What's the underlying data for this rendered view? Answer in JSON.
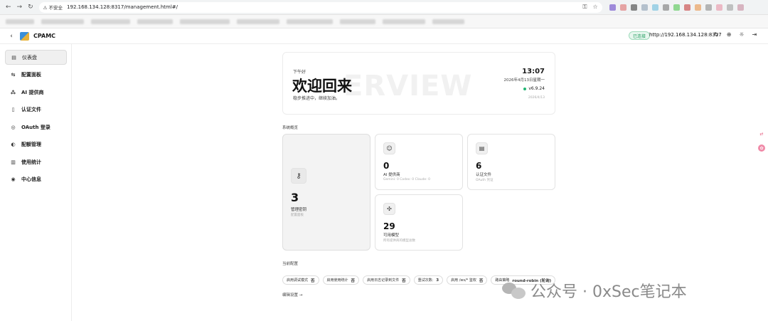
{
  "browser": {
    "insecure": "不安全",
    "url": "192.168.134.128:8317/management.html#/"
  },
  "header": {
    "back": "‹",
    "brand": "CPAMC",
    "status": "已连接",
    "server": "http://192.168.134.128:8317"
  },
  "sidebar": {
    "items": [
      {
        "label": "仪表盘",
        "icon": "dashboard-icon",
        "glyph": "▤"
      },
      {
        "label": "配置面板",
        "icon": "sliders-icon",
        "glyph": "⇆"
      },
      {
        "label": "AI 提供商",
        "icon": "network-icon",
        "glyph": "⁂"
      },
      {
        "label": "认证文件",
        "icon": "file-icon",
        "glyph": "▯"
      },
      {
        "label": "OAuth 登录",
        "icon": "shield-icon",
        "glyph": "◎"
      },
      {
        "label": "配额管理",
        "icon": "gauge-icon",
        "glyph": "◐"
      },
      {
        "label": "使用统计",
        "icon": "bar-chart-icon",
        "glyph": "▥"
      },
      {
        "label": "中心信息",
        "icon": "info-icon",
        "glyph": "◉"
      }
    ]
  },
  "welcome": {
    "greeting": "下午好",
    "title": "欢迎回来",
    "subtitle": "稳步推进中，继续加油。",
    "watermark": "ERVIEW",
    "time": "13:07",
    "date": "2026年4月13日星期一",
    "version": "v6.9.24",
    "build_date": "2026/4/13"
  },
  "overview": {
    "title": "系统概览",
    "cards": [
      {
        "value": "3",
        "label": "管理密钥",
        "sub": "配置面板",
        "icon": "key-icon",
        "glyph": "⚷"
      },
      {
        "value": "0",
        "label": "AI 提供商",
        "sub": "Gemini: 0 Codex: 0 Claude: 0",
        "icon": "robot-icon",
        "glyph": "☺"
      },
      {
        "value": "6",
        "label": "认证文件",
        "sub": "OAuth 凭证",
        "icon": "document-icon",
        "glyph": "▤"
      },
      {
        "value": "29",
        "label": "可用模型",
        "sub": "所有提供商的模型总数",
        "icon": "models-icon",
        "glyph": "✣"
      }
    ]
  },
  "current_config": {
    "title": "当前配置",
    "chips": [
      {
        "label": "启用调试模式",
        "value": "否"
      },
      {
        "label": "启用使用统计",
        "value": "否"
      },
      {
        "label": "启用日志记录到文件",
        "value": "否"
      },
      {
        "label": "重试次数:",
        "value": "3"
      },
      {
        "label": "启用 /ws/* 鉴权",
        "value": "否"
      },
      {
        "label": "路由策略",
        "value": "round-robin (轮询)"
      }
    ],
    "edit": "编辑设置 →"
  },
  "watermark_overlay": "公众号 · 0xSec笔记本"
}
